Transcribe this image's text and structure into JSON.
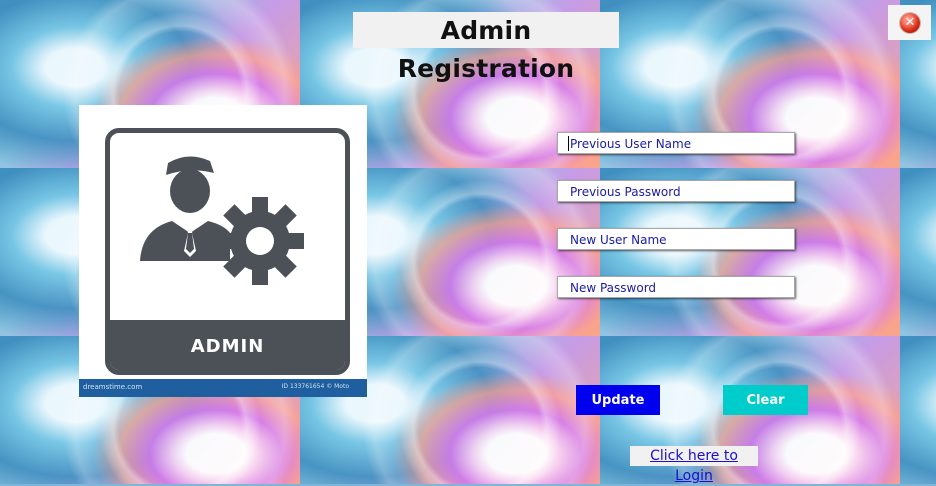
{
  "window": {
    "title": "Admin Registration"
  },
  "close_button": {
    "icon": "close-icon"
  },
  "admin_image": {
    "label": "ADMIN",
    "footer_left": "dreamstime.com",
    "footer_right": "ID 133761654 © Moto",
    "icons": [
      "admin-user-icon",
      "gear-icon"
    ]
  },
  "form": {
    "previous_user_name": {
      "placeholder": "Previous User Name",
      "value": ""
    },
    "previous_password": {
      "placeholder": "Previous Password",
      "value": ""
    },
    "new_user_name": {
      "placeholder": "New User Name",
      "value": ""
    },
    "new_password": {
      "placeholder": "New Password",
      "value": ""
    }
  },
  "buttons": {
    "update": "Update",
    "clear": "Clear"
  },
  "login_link": "Click here to Login",
  "colors": {
    "update_button": "#0000ee",
    "clear_button": "#00cccc",
    "field_text": "#1a1aa6",
    "link": "#1a0fcc"
  }
}
